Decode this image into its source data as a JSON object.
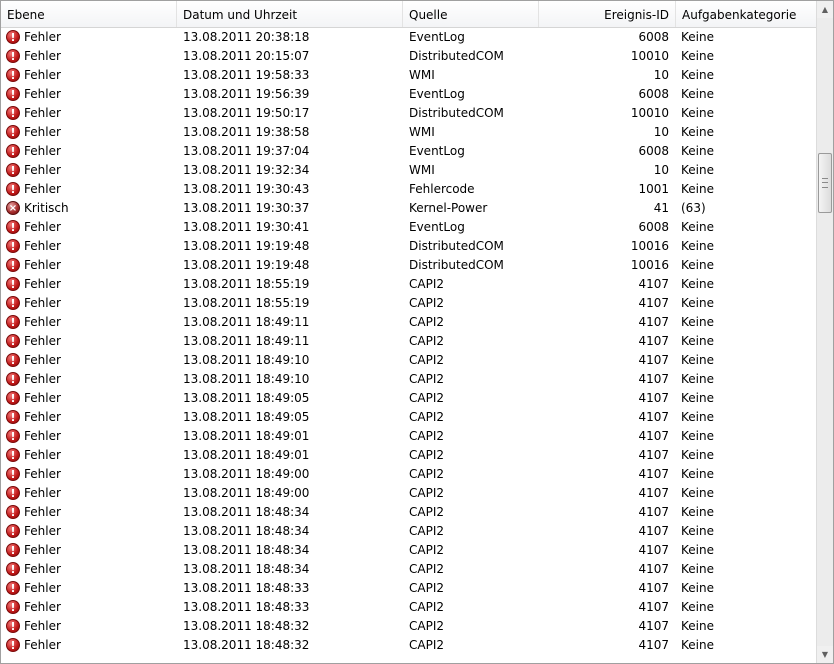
{
  "columns": {
    "level": "Ebene",
    "datetime": "Datum und Uhrzeit",
    "source": "Quelle",
    "event_id": "Ereignis-ID",
    "task_category": "Aufgabenkategorie"
  },
  "icons": {
    "error": "error-icon",
    "critical": "critical-icon"
  },
  "colors": {
    "error": "#c01818",
    "critical": "#a32a2a"
  },
  "rows": [
    {
      "icon": "error",
      "level": "Fehler",
      "datetime": "13.08.2011 20:38:18",
      "source": "EventLog",
      "event_id": "6008",
      "category": "Keine"
    },
    {
      "icon": "error",
      "level": "Fehler",
      "datetime": "13.08.2011 20:15:07",
      "source": "DistributedCOM",
      "event_id": "10010",
      "category": "Keine"
    },
    {
      "icon": "error",
      "level": "Fehler",
      "datetime": "13.08.2011 19:58:33",
      "source": "WMI",
      "event_id": "10",
      "category": "Keine"
    },
    {
      "icon": "error",
      "level": "Fehler",
      "datetime": "13.08.2011 19:56:39",
      "source": "EventLog",
      "event_id": "6008",
      "category": "Keine"
    },
    {
      "icon": "error",
      "level": "Fehler",
      "datetime": "13.08.2011 19:50:17",
      "source": "DistributedCOM",
      "event_id": "10010",
      "category": "Keine"
    },
    {
      "icon": "error",
      "level": "Fehler",
      "datetime": "13.08.2011 19:38:58",
      "source": "WMI",
      "event_id": "10",
      "category": "Keine"
    },
    {
      "icon": "error",
      "level": "Fehler",
      "datetime": "13.08.2011 19:37:04",
      "source": "EventLog",
      "event_id": "6008",
      "category": "Keine"
    },
    {
      "icon": "error",
      "level": "Fehler",
      "datetime": "13.08.2011 19:32:34",
      "source": "WMI",
      "event_id": "10",
      "category": "Keine"
    },
    {
      "icon": "error",
      "level": "Fehler",
      "datetime": "13.08.2011 19:30:43",
      "source": "Fehlercode",
      "event_id": "1001",
      "category": "Keine"
    },
    {
      "icon": "critical",
      "level": "Kritisch",
      "datetime": "13.08.2011 19:30:37",
      "source": "Kernel-Power",
      "event_id": "41",
      "category": "(63)"
    },
    {
      "icon": "error",
      "level": "Fehler",
      "datetime": "13.08.2011 19:30:41",
      "source": "EventLog",
      "event_id": "6008",
      "category": "Keine"
    },
    {
      "icon": "error",
      "level": "Fehler",
      "datetime": "13.08.2011 19:19:48",
      "source": "DistributedCOM",
      "event_id": "10016",
      "category": "Keine"
    },
    {
      "icon": "error",
      "level": "Fehler",
      "datetime": "13.08.2011 19:19:48",
      "source": "DistributedCOM",
      "event_id": "10016",
      "category": "Keine"
    },
    {
      "icon": "error",
      "level": "Fehler",
      "datetime": "13.08.2011 18:55:19",
      "source": "CAPI2",
      "event_id": "4107",
      "category": "Keine"
    },
    {
      "icon": "error",
      "level": "Fehler",
      "datetime": "13.08.2011 18:55:19",
      "source": "CAPI2",
      "event_id": "4107",
      "category": "Keine"
    },
    {
      "icon": "error",
      "level": "Fehler",
      "datetime": "13.08.2011 18:49:11",
      "source": "CAPI2",
      "event_id": "4107",
      "category": "Keine"
    },
    {
      "icon": "error",
      "level": "Fehler",
      "datetime": "13.08.2011 18:49:11",
      "source": "CAPI2",
      "event_id": "4107",
      "category": "Keine"
    },
    {
      "icon": "error",
      "level": "Fehler",
      "datetime": "13.08.2011 18:49:10",
      "source": "CAPI2",
      "event_id": "4107",
      "category": "Keine"
    },
    {
      "icon": "error",
      "level": "Fehler",
      "datetime": "13.08.2011 18:49:10",
      "source": "CAPI2",
      "event_id": "4107",
      "category": "Keine"
    },
    {
      "icon": "error",
      "level": "Fehler",
      "datetime": "13.08.2011 18:49:05",
      "source": "CAPI2",
      "event_id": "4107",
      "category": "Keine"
    },
    {
      "icon": "error",
      "level": "Fehler",
      "datetime": "13.08.2011 18:49:05",
      "source": "CAPI2",
      "event_id": "4107",
      "category": "Keine"
    },
    {
      "icon": "error",
      "level": "Fehler",
      "datetime": "13.08.2011 18:49:01",
      "source": "CAPI2",
      "event_id": "4107",
      "category": "Keine"
    },
    {
      "icon": "error",
      "level": "Fehler",
      "datetime": "13.08.2011 18:49:01",
      "source": "CAPI2",
      "event_id": "4107",
      "category": "Keine"
    },
    {
      "icon": "error",
      "level": "Fehler",
      "datetime": "13.08.2011 18:49:00",
      "source": "CAPI2",
      "event_id": "4107",
      "category": "Keine"
    },
    {
      "icon": "error",
      "level": "Fehler",
      "datetime": "13.08.2011 18:49:00",
      "source": "CAPI2",
      "event_id": "4107",
      "category": "Keine"
    },
    {
      "icon": "error",
      "level": "Fehler",
      "datetime": "13.08.2011 18:48:34",
      "source": "CAPI2",
      "event_id": "4107",
      "category": "Keine"
    },
    {
      "icon": "error",
      "level": "Fehler",
      "datetime": "13.08.2011 18:48:34",
      "source": "CAPI2",
      "event_id": "4107",
      "category": "Keine"
    },
    {
      "icon": "error",
      "level": "Fehler",
      "datetime": "13.08.2011 18:48:34",
      "source": "CAPI2",
      "event_id": "4107",
      "category": "Keine"
    },
    {
      "icon": "error",
      "level": "Fehler",
      "datetime": "13.08.2011 18:48:34",
      "source": "CAPI2",
      "event_id": "4107",
      "category": "Keine"
    },
    {
      "icon": "error",
      "level": "Fehler",
      "datetime": "13.08.2011 18:48:33",
      "source": "CAPI2",
      "event_id": "4107",
      "category": "Keine"
    },
    {
      "icon": "error",
      "level": "Fehler",
      "datetime": "13.08.2011 18:48:33",
      "source": "CAPI2",
      "event_id": "4107",
      "category": "Keine"
    },
    {
      "icon": "error",
      "level": "Fehler",
      "datetime": "13.08.2011 18:48:32",
      "source": "CAPI2",
      "event_id": "4107",
      "category": "Keine"
    },
    {
      "icon": "error",
      "level": "Fehler",
      "datetime": "13.08.2011 18:48:32",
      "source": "CAPI2",
      "event_id": "4107",
      "category": "Keine"
    }
  ]
}
